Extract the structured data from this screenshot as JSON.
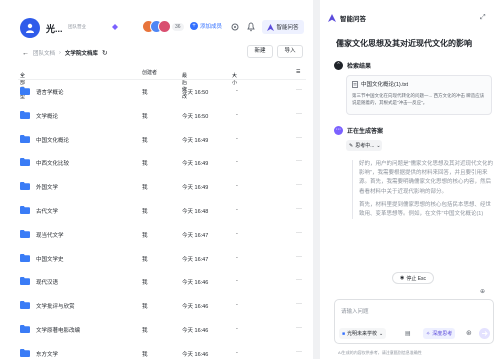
{
  "team": {
    "name": "光...",
    "tag": "团队营业",
    "member_count": "36",
    "add_member": "添加成员",
    "ai_button": "智能问答"
  },
  "breadcrumb": {
    "root": "团队文档",
    "current": "文学院文档库"
  },
  "toolbar": {
    "new_label": "新建",
    "import_label": "导入"
  },
  "table": {
    "headers": {
      "type": "全部类型",
      "creator": "创建者",
      "modified": "最后修改",
      "size": "大小"
    },
    "rows": [
      {
        "name": "语言学概论",
        "creator": "我",
        "modified": "今天 16:50"
      },
      {
        "name": "文学概论",
        "creator": "我",
        "modified": "今天 16:50"
      },
      {
        "name": "中国文化概论",
        "creator": "我",
        "modified": "今天 16:49"
      },
      {
        "name": "中西文化比较",
        "creator": "我",
        "modified": "今天 16:49"
      },
      {
        "name": "外国文学",
        "creator": "我",
        "modified": "今天 16:49"
      },
      {
        "name": "古代文学",
        "creator": "我",
        "modified": "今天 16:48"
      },
      {
        "name": "现当代文学",
        "creator": "我",
        "modified": "今天 16:47"
      },
      {
        "name": "中国文学史",
        "creator": "我",
        "modified": "今天 16:47"
      },
      {
        "name": "现代汉语",
        "creator": "我",
        "modified": "今天 16:46"
      },
      {
        "name": "文学批评与欣赏",
        "creator": "我",
        "modified": "今天 16:46"
      },
      {
        "name": "文学原著电影改编",
        "creator": "我",
        "modified": "今天 16:46"
      },
      {
        "name": "东方文学",
        "creator": "我",
        "modified": "今天 16:46"
      }
    ]
  },
  "assistant": {
    "title": "智能问答",
    "question": "儒家文化思想及其对近现代文化的影响",
    "search_step": "检索结果",
    "file_name": "中国文化概论(1).txt",
    "file_excerpt": "第三节中国文化在向现代转化的问题一... 西方文化的冲击 瞬造应该说是随着的，其根式是\"冲击—反应\"。",
    "generating_step": "正在生成答案",
    "thinking_label": "思考中...",
    "answer_p1": "好的，用户的问题是\"儒家文化思想及其对近现代文化的影响\"，我需要根据提供的材料来回答，并且要引用来源。首先，我需要明确儒家文化思想的核心内容，然后看看材料中关于近现代影响的部分。",
    "answer_p2": "首先，材料里提到儒家思想的核心包括民本思想、经世致用、变革思想等。例如，在文件\"中国文化概论(1)",
    "stop_label": "停止 Esc",
    "input_placeholder": "请输入问题",
    "scope_label": "光明未来学校",
    "deep_label": "深度思考",
    "footnote": "AI生成的内容仅供参考，请注意甄别信息准确性"
  }
}
